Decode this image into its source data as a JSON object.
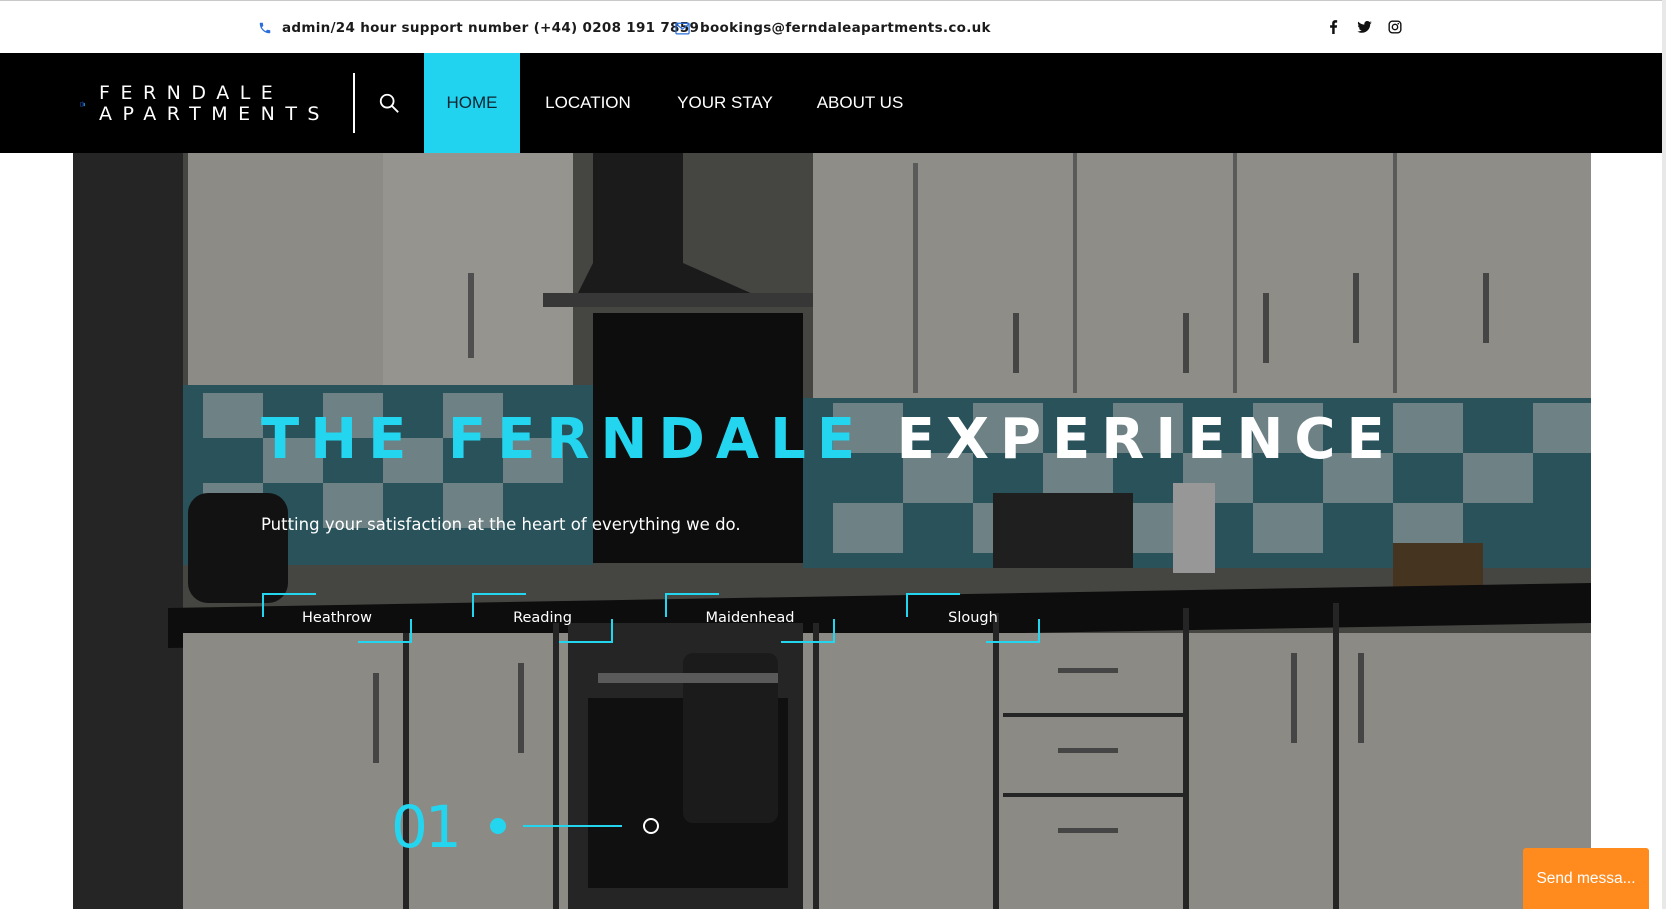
{
  "topbar": {
    "phone": "admin/24 hour support number (+44) 0208 191 7859",
    "email": "bookings@ferndaleapartments.co.uk",
    "social_icons": [
      "facebook-icon",
      "twitter-icon",
      "instagram-icon"
    ]
  },
  "logo": {
    "line1": "FERNDALE",
    "line2": "APARTMENTS"
  },
  "nav": {
    "items": [
      {
        "label": "HOME",
        "active": true
      },
      {
        "label": "LOCATION",
        "active": false
      },
      {
        "label": "YOUR STAY",
        "active": false
      },
      {
        "label": "ABOUT US",
        "active": false
      }
    ]
  },
  "hero": {
    "headline_accent": "THE FERNDALE",
    "headline_rest": "EXPERIENCE",
    "subheading": "Putting your satisfaction at the heart of everything we do.",
    "locations": [
      "Heathrow",
      "Reading",
      "Maidenhead",
      "Slough"
    ],
    "slide_number": "01",
    "slide_total_dots": 2,
    "slide_active_index": 0
  },
  "chat": {
    "button_label": "Send messa..."
  },
  "colors": {
    "accent": "#24d5ef",
    "nav_bg": "#000000",
    "chat_button": "#ff8a1e",
    "logo_blue": "#1f5fe0"
  }
}
